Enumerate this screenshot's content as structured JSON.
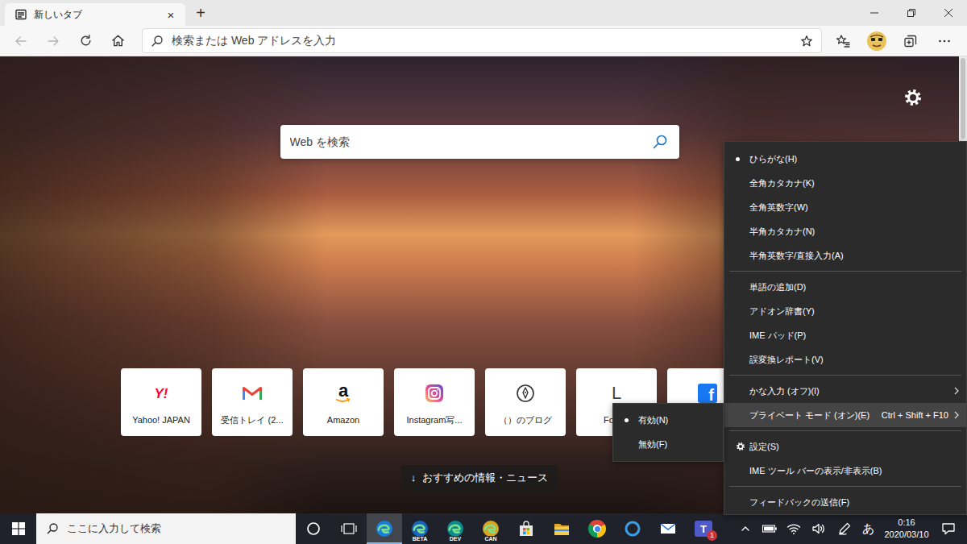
{
  "window": {
    "tabs": [
      {
        "label": "新しいタブ",
        "close": "×",
        "selected": true
      }
    ],
    "new_tab": "+"
  },
  "toolbar": {
    "back": {
      "disabled": true
    },
    "forward": {
      "disabled": true
    },
    "address": {
      "placeholder": "検索または Web アドレスを入力"
    }
  },
  "new_tab_page": {
    "search": {
      "placeholder": "Web を検索"
    },
    "quick_links": [
      {
        "kind": "yahoo",
        "logo": "Y!",
        "label": "Yahoo! JAPAN"
      },
      {
        "kind": "gmail",
        "label": "受信トレイ (2..."
      },
      {
        "kind": "amazon",
        "logo": "a",
        "label": "Amazon"
      },
      {
        "kind": "instagram",
        "label": "Instagram写..."
      },
      {
        "kind": "blog",
        "label": "（）のブログ"
      },
      {
        "kind": "letter",
        "logo": "L",
        "label": "Follow"
      },
      {
        "kind": "facebook",
        "logo": "f"
      }
    ],
    "news_button": {
      "arrow": "↓",
      "label": "おすすめの情報・ニュース"
    }
  },
  "ime_menu": {
    "items": [
      {
        "kind": "option",
        "label": "ひらがな(H)",
        "selected": true
      },
      {
        "kind": "option",
        "label": "全角カタカナ(K)",
        "selected": false
      },
      {
        "kind": "option",
        "label": "全角英数字(W)",
        "selected": false
      },
      {
        "kind": "option",
        "label": "半角カタカナ(N)",
        "selected": false
      },
      {
        "kind": "option",
        "label": "半角英数字/直接入力(A)",
        "selected": false
      },
      {
        "kind": "separator"
      },
      {
        "kind": "command",
        "label": "単語の追加(D)"
      },
      {
        "kind": "command",
        "label": "アドオン辞書(Y)"
      },
      {
        "kind": "command",
        "label": "IME パッド(P)"
      },
      {
        "kind": "command",
        "label": "誤変換レポート(V)"
      },
      {
        "kind": "separator"
      },
      {
        "kind": "submenu",
        "label": "かな入力 (オフ)(I)",
        "highlighted": false
      },
      {
        "kind": "submenu",
        "label": "プライベート モード (オン)(E)",
        "shortcut": "Ctrl + Shift + F10",
        "highlighted": true
      },
      {
        "kind": "separator"
      },
      {
        "kind": "settings",
        "label": "設定(S)"
      },
      {
        "kind": "command",
        "label": "IME ツール バーの表示/非表示(B)"
      },
      {
        "kind": "separator"
      },
      {
        "kind": "command",
        "label": "フィードバックの送信(F)"
      }
    ]
  },
  "ime_submenu": {
    "items": [
      {
        "label": "有効(N)",
        "selected": true
      },
      {
        "label": "無効(F)",
        "selected": false
      }
    ]
  },
  "taskbar": {
    "search": {
      "placeholder": "ここに入力して検索"
    },
    "apps": [
      {
        "kind": "cortana",
        "active": false
      },
      {
        "kind": "taskview",
        "active": false
      },
      {
        "kind": "edge",
        "color": "#1a7fd6",
        "active": true
      },
      {
        "kind": "edge",
        "channel": "BETA",
        "color": "#1565c0",
        "active": false
      },
      {
        "kind": "edge",
        "channel": "DEV",
        "color": "#0b8a8f",
        "active": false
      },
      {
        "kind": "edge",
        "channel": "CAN",
        "color": "#d9a420",
        "active": false
      },
      {
        "kind": "store",
        "active": false
      },
      {
        "kind": "explorer",
        "active": false
      },
      {
        "kind": "chrome",
        "active": false
      },
      {
        "kind": "assistant",
        "active": false
      },
      {
        "kind": "mail",
        "active": false
      },
      {
        "kind": "teams",
        "logo": "T",
        "badge": "1",
        "active": false
      }
    ],
    "tray": {
      "ime": "あ",
      "time": "0:16",
      "date": "2020/03/10"
    }
  }
}
